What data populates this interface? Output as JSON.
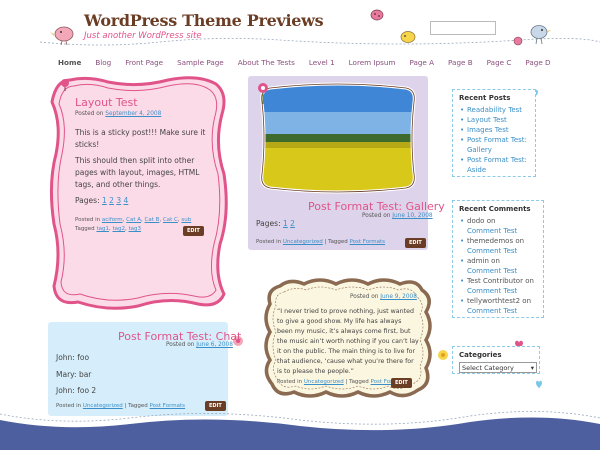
{
  "header": {
    "title": "WordPress Theme Previews",
    "description": "Just another WordPress site",
    "search_placeholder": ""
  },
  "nav": {
    "items": [
      "Home",
      "Blog",
      "Front Page",
      "Sample Page",
      "About The Tests",
      "Level 1",
      "Lorem Ipsum",
      "Page A",
      "Page B",
      "Page C",
      "Page D"
    ]
  },
  "posts": {
    "layout": {
      "title": "Layout Test",
      "meta_prefix": "Posted on",
      "date": "September 4, 2008",
      "p1": "This is a sticky post!!! Make sure it sticks!",
      "p2": "This should then split into other pages with layout, images, HTML tags, and other things.",
      "pages_label": "Pages:",
      "pages": [
        "1",
        "2",
        "3",
        "4"
      ],
      "cats_prefix": "Posted in",
      "cats": [
        "aciform",
        "Cat A",
        "Cat B",
        "Cat C",
        "sub"
      ],
      "tags_prefix": "Tagged",
      "tags": [
        "tag1",
        "tag2",
        "tag3"
      ],
      "edit": "EDIT"
    },
    "gallery": {
      "title": "Post Format Test: Gallery",
      "meta_prefix": "Posted on",
      "date": "June 10, 2008",
      "pages_label": "Pages:",
      "pages": [
        "1",
        "2"
      ],
      "cats_prefix": "Posted in",
      "cat": "Uncategorized",
      "tags_prefix": "| Tagged",
      "tag": "Post Formats",
      "edit": "EDIT"
    },
    "chat": {
      "title": "Post Format Test: Chat",
      "meta_prefix": "Posted on",
      "date": "June 6, 2008",
      "line1": "John: foo",
      "line2": "Mary: bar",
      "line3": "John: foo 2",
      "cats_prefix": "Posted in",
      "cat": "Uncategorized",
      "tags_prefix": "| Tagged",
      "tag": "Post Formats",
      "edit": "EDIT"
    },
    "quote": {
      "meta_prefix": "Posted on",
      "date": "June 9, 2008",
      "text": "“I never tried to prove nothing, just wanted to give a good show. My life has always been my music, it’s always come first, but the music ain’t worth nothing if you can’t lay it on the public. The main thing is to live for that audience, ‘cause what you’re there for is to please the people.”",
      "cats_prefix": "Posted in",
      "cat": "Uncategorized",
      "tags_prefix": "| Tagged",
      "tag": "Post Formats",
      "edit": "EDIT"
    }
  },
  "sidebar": {
    "recent_posts": {
      "title": "Recent Posts",
      "items": [
        "Readability Test",
        "Layout Test",
        "Images Test",
        "Post Format Test: Gallery",
        "Post Format Test: Aside"
      ]
    },
    "recent_comments": {
      "title": "Recent Comments",
      "items": [
        {
          "author": "dodo",
          "on": "on",
          "post": "Comment Test"
        },
        {
          "author": "themedemos",
          "on": "on",
          "post": "Comment Test"
        },
        {
          "author": "admin",
          "on": "on",
          "post": "Comment Test"
        },
        {
          "author": "Test Contributor",
          "on": "on",
          "post": "Comment Test"
        },
        {
          "author": "tellyworthtest2",
          "on": "on",
          "post": "Comment Test"
        }
      ]
    },
    "categories": {
      "title": "Categories",
      "selected": "Select Category"
    }
  },
  "colors": {
    "title_brown": "#6b3d25",
    "pink": "#e0548a",
    "link_blue": "#3b8fc8",
    "nav_purple": "#8a4e7d",
    "wave_blue": "#4d5f9e"
  }
}
